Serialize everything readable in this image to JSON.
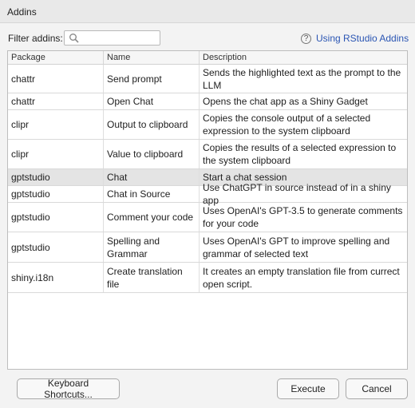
{
  "window": {
    "title": "Addins"
  },
  "filter": {
    "label": "Filter addins:",
    "value": "",
    "placeholder": ""
  },
  "help": {
    "label": "Using RStudio Addins",
    "icon": "question-circle-icon"
  },
  "table": {
    "columns": [
      "Package",
      "Name",
      "Description"
    ],
    "rows": [
      {
        "package": "chattr",
        "name": "Send prompt",
        "description": "Sends the highlighted text as the prompt to the LLM"
      },
      {
        "package": "chattr",
        "name": "Open Chat",
        "description": "Opens the chat app as a Shiny Gadget"
      },
      {
        "package": "clipr",
        "name": "Output to clipboard",
        "description": "Copies the console output of a selected expression to the system clipboard"
      },
      {
        "package": "clipr",
        "name": "Value to clipboard",
        "description": "Copies the results of a selected expression to the system clipboard"
      },
      {
        "package": "gptstudio",
        "name": "Chat",
        "description": "Start a chat session",
        "selected": true
      },
      {
        "package": "gptstudio",
        "name": "Chat in Source",
        "description": "Use ChatGPT in source instead of in a shiny app"
      },
      {
        "package": "gptstudio",
        "name": "Comment your code",
        "description": "Uses OpenAI's GPT-3.5 to generate comments for your code"
      },
      {
        "package": "gptstudio",
        "name": "Spelling and Grammar",
        "description": "Uses OpenAI's GPT to improve spelling and grammar of selected text"
      },
      {
        "package": "shiny.i18n",
        "name": "Create translation file",
        "description": "It creates an empty translation file from currect open script."
      }
    ]
  },
  "buttons": {
    "keyboard_shortcuts": "Keyboard Shortcuts...",
    "execute": "Execute",
    "cancel": "Cancel"
  },
  "colors": {
    "link": "#2a55b3",
    "selected_row": "#e4e4e4"
  }
}
